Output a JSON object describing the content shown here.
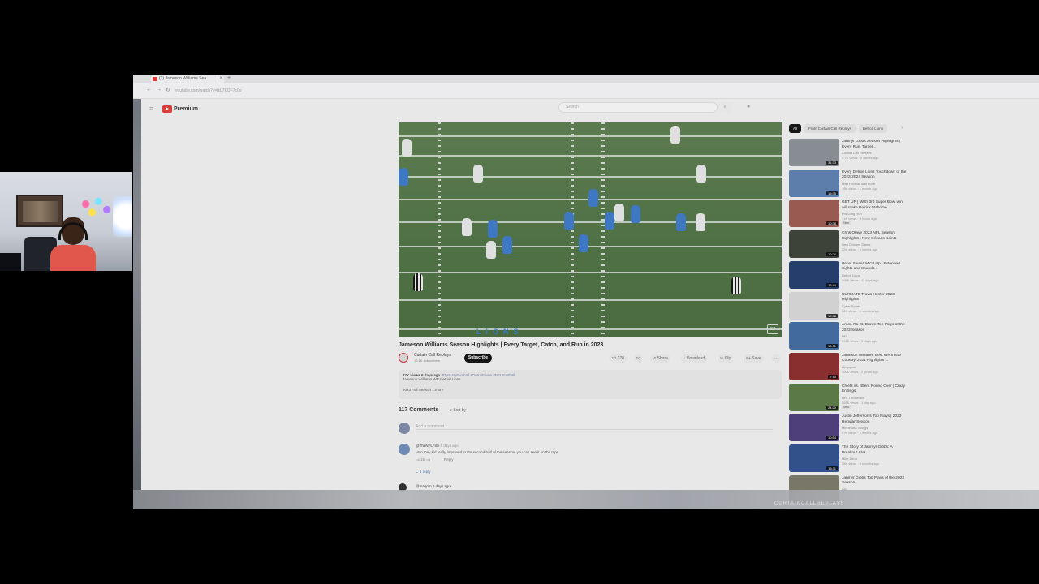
{
  "browser": {
    "tab_title": "(1) Jameson Williams Sea",
    "url": "youtube.com/watch?v=lzL7KQF7c0o"
  },
  "youtube": {
    "logo_text": "Premium",
    "search_placeholder": "Search"
  },
  "video": {
    "title": "Jameson Williams Season Highlights | Every Target, Catch, and Run in 2023",
    "channel_name": "Curtain Call Replays",
    "channel_subs": "10.1K subscribers",
    "subscribe_label": "Subscribe",
    "likes": "370",
    "actions": [
      "Share",
      "Download",
      "Clip",
      "Save"
    ],
    "description_meta": "27K views  6 days ago",
    "description_tags": "#DynastyFootball #DetroitLions #NFLFootball",
    "description_line": "Jameson Williams WR Detroit Lions",
    "description_more": "2023 Full Season  ...more"
  },
  "comments": {
    "count_label": "117 Comments",
    "sort_label": "Sort by",
    "add_placeholder": "Add a comment...",
    "items": [
      {
        "author": "@TheNFLFilm",
        "time": "6 days ago",
        "text": "Man they kid really improved in the second half of the season, you can see it on the tape",
        "likes": "15",
        "reply_label": "Reply",
        "replies_label": "1 reply"
      },
      {
        "author": "@maqrim",
        "time": "6 days ago"
      }
    ]
  },
  "sidebar": {
    "chips": [
      "All",
      "From Curtain Call Replays",
      "Detroit Lions"
    ],
    "recommendations": [
      {
        "title": "Jahmyr Gibbs Season Highlights | Every Run, Target...",
        "channel": "Curtain Call Replays",
        "meta": "4.7K views · 2 weeks ago",
        "duration": "31:33",
        "thumb": "#8a8f96"
      },
      {
        "title": "Every Detroit Lions Touchdown of the 2023-2024 Season",
        "channel": "Matt Football and more",
        "meta": "78K views · 1 month ago",
        "duration": "15:35",
        "thumb": "#5c7fb0"
      },
      {
        "title": "GET UP | 'With 3rd Super Bowl win will make Patrick Mahome...",
        "channel": "Pro Long Run",
        "meta": "71K views · 8 hours ago",
        "duration": "10:38",
        "thumb": "#9b5a4f",
        "badge": "New"
      },
      {
        "title": "Chris Olave 2023 NFL Season Highlights : New Orleans Saints",
        "channel": "New Orleans Saints",
        "meta": "22K views · 4 weeks ago",
        "duration": "10:24",
        "thumb": "#3a3f35"
      },
      {
        "title": "Penei Sewell Mic'd Up | Extended Sights and Sounds...",
        "channel": "Detroit Lions",
        "meta": "108K views · 11 days ago",
        "duration": "12:44",
        "thumb": "#1f3a6b"
      },
      {
        "title": "ULTIMATE Travis Hunter 2023 Highlights",
        "channel": "Cyber Sports",
        "meta": "56K views · 1 months ago",
        "duration": "12:38",
        "thumb": "#d9d9d9"
      },
      {
        "title": "Amon-Ra St. Brown Top Plays of the 2023 Season",
        "channel": "NFL",
        "meta": "331K views · 3 days ago",
        "duration": "10:01",
        "thumb": "#3f6aa0"
      },
      {
        "title": "Jameson Williams 'Best WR in the Country' 2021 Highlights ...",
        "channel": "stingsport",
        "meta": "100K views · 2 years ago",
        "duration": "7:13",
        "thumb": "#8c2a2a"
      },
      {
        "title": "Chiefs vs. 49ers Round Over | Crazy Endings",
        "channel": "NFL Throwback",
        "meta": "568K views · 1 day ago",
        "duration": "24:20",
        "thumb": "#5a7a44",
        "badge": "New"
      },
      {
        "title": "Justin Jefferson's Top Plays | 2023 Regular Season",
        "channel": "Minnesota Vikings",
        "meta": "57K views · 3 weeks ago",
        "duration": "10:54",
        "thumb": "#4b3a7a"
      },
      {
        "title": "The Story of Jahmyr Gibbs: A Breakout Star",
        "channel": "Mike Zena",
        "meta": "28K views · 3 months ago",
        "duration": "16:11",
        "thumb": "#2d4f8c"
      },
      {
        "title": "Jahmyr Gibbs Top Plays of the 2023 Season",
        "channel": "NFL",
        "meta": "",
        "duration": "",
        "thumb": "#7a7868"
      }
    ]
  },
  "stream": {
    "watermark": "CURTAINCALLREPLAYS"
  }
}
